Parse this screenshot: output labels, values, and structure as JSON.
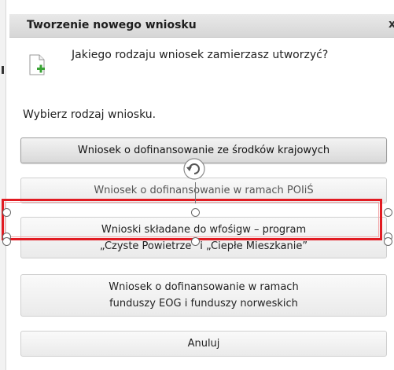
{
  "dialog": {
    "title": "Tworzenie nowego wniosku",
    "close_glyph": "x",
    "icon": "document-add-icon",
    "question": "Jakiego rodzaju wniosek zamierzasz utworzyć?",
    "instruction": "Wybierz rodzaj wniosku."
  },
  "options": [
    {
      "lines": [
        "Wniosek o dofinansowanie ze środków krajowych"
      ]
    },
    {
      "lines": [
        "Wniosek o dofinansowanie w ramach POIiŚ"
      ]
    },
    {
      "lines": [
        "Wnioski składane do wfośigw – program",
        "„Czyste Powietrze” i „Ciepłe Mieszkanie”"
      ]
    },
    {
      "lines": [
        "Wniosek o dofinansowanie w ramach",
        "funduszy EOG i funduszy norweskich"
      ]
    }
  ],
  "cancel_label": "Anuluj",
  "colors": {
    "selection_border": "#e11b22",
    "titlebar": "#dcdcdc",
    "plus_icon": "#3aa335"
  }
}
